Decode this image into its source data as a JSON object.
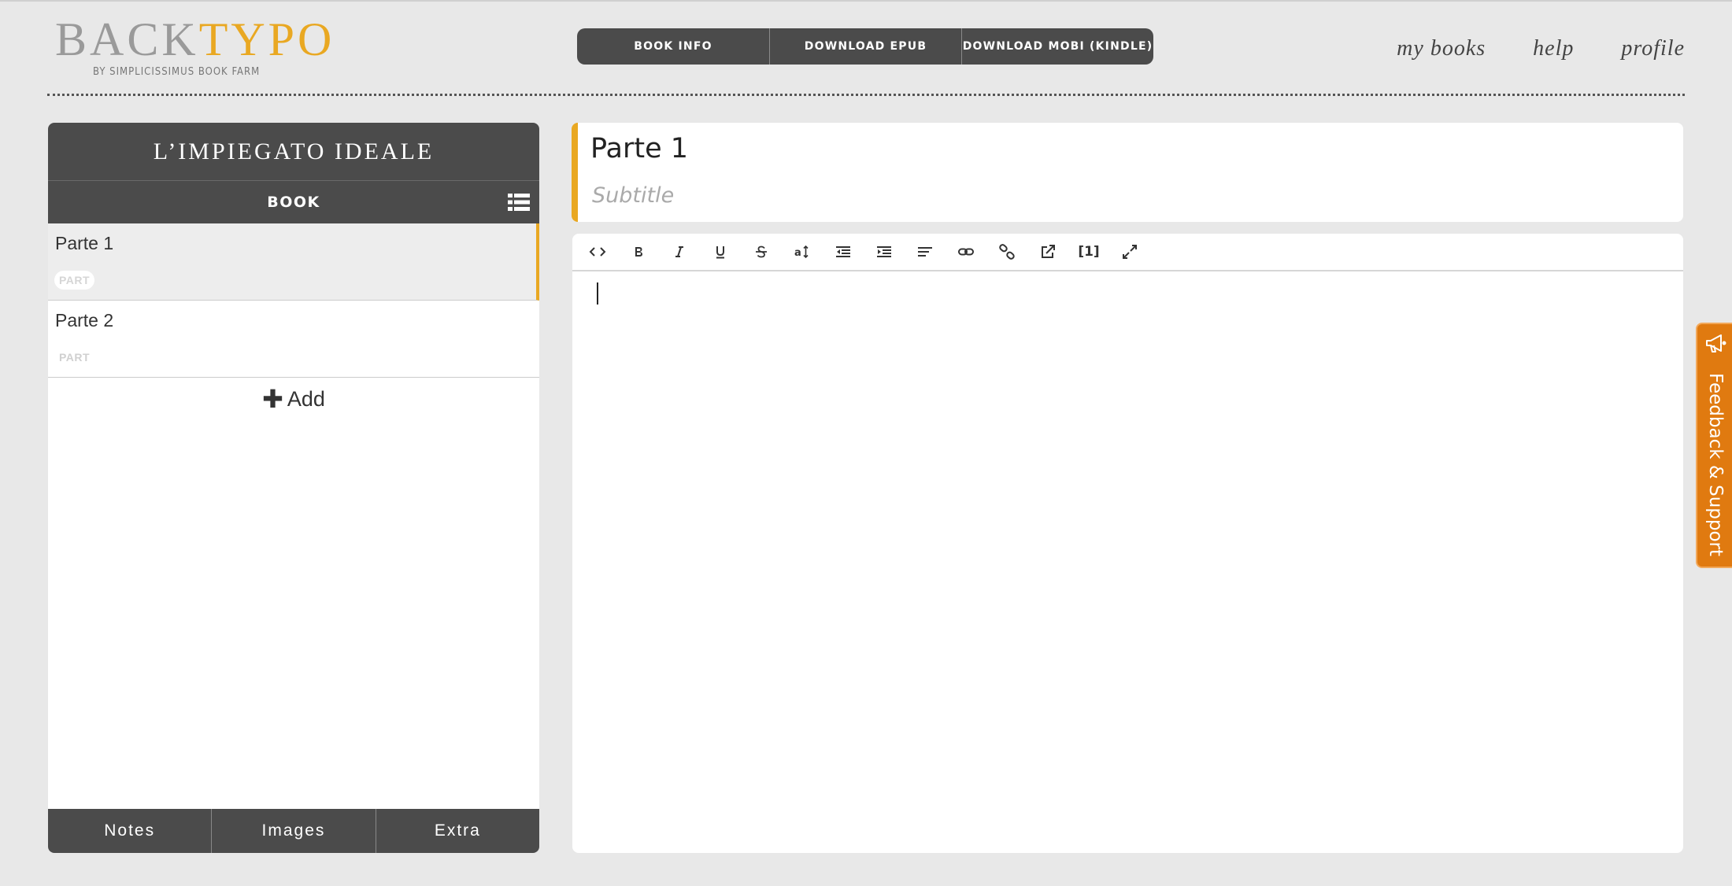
{
  "header": {
    "logo_back": "BACK",
    "logo_typo": "TYPO",
    "logo_sub": "BY SIMPLICISSIMUS BOOK FARM",
    "actions": [
      "BOOK INFO",
      "DOWNLOAD EPUB",
      "DOWNLOAD MOBI (KINDLE)"
    ],
    "nav": [
      "my books",
      "help",
      "profile"
    ]
  },
  "sidebar": {
    "book_title": "L’IMPIEGATO IDEALE",
    "section_label": "BOOK",
    "parts": [
      {
        "name": "Parte 1",
        "type": "PART",
        "active": true
      },
      {
        "name": "Parte 2",
        "type": "PART",
        "active": false
      }
    ],
    "add_label": "Add",
    "footer": [
      "Notes",
      "Images",
      "Extra"
    ]
  },
  "editor": {
    "title_value": "Parte 1",
    "subtitle_placeholder": "Subtitle",
    "footnote_label": "[1]"
  },
  "feedback": {
    "label": "Feedback & Support"
  },
  "colors": {
    "accent": "#e9a822",
    "dark": "#4b4b4b",
    "feedback": "#e07a10"
  }
}
